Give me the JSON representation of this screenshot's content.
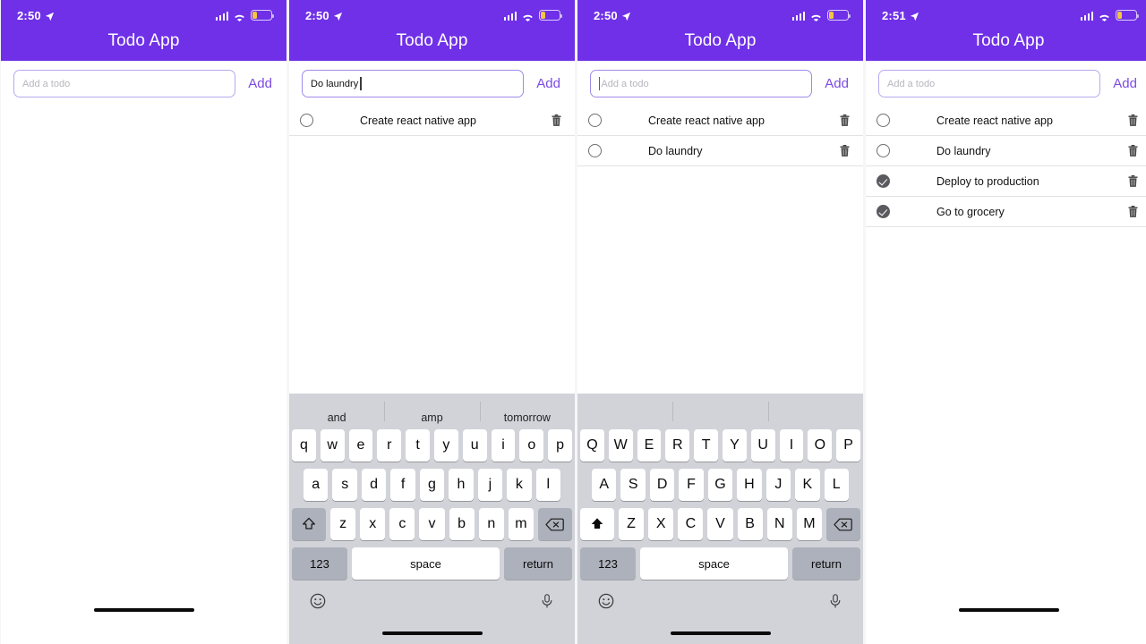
{
  "app": {
    "title": "Todo App",
    "header_color": "#6f30e8",
    "accent_color": "#7b4ae2",
    "add_label": "Add",
    "input_placeholder": "Add a todo",
    "icons": {
      "location": "location-arrow-icon",
      "signal": "cellular-signal-icon",
      "wifi": "wifi-icon",
      "battery": "battery-low-icon",
      "delete": "trash-icon",
      "checkbox_empty": "circle-unchecked-icon",
      "checkbox_done": "circle-checked-icon",
      "emoji": "emoji-icon",
      "mic": "microphone-icon",
      "shift": "shift-icon",
      "backspace": "backspace-icon"
    }
  },
  "keyboard": {
    "row1_lower": [
      "q",
      "w",
      "e",
      "r",
      "t",
      "y",
      "u",
      "i",
      "o",
      "p"
    ],
    "row2_lower": [
      "a",
      "s",
      "d",
      "f",
      "g",
      "h",
      "j",
      "k",
      "l"
    ],
    "row3_lower": [
      "z",
      "x",
      "c",
      "v",
      "b",
      "n",
      "m"
    ],
    "row1_upper": [
      "Q",
      "W",
      "E",
      "R",
      "T",
      "Y",
      "U",
      "I",
      "O",
      "P"
    ],
    "row2_upper": [
      "A",
      "S",
      "D",
      "F",
      "G",
      "H",
      "J",
      "K",
      "L"
    ],
    "row3_upper": [
      "Z",
      "X",
      "C",
      "V",
      "B",
      "N",
      "M"
    ],
    "numeric_label": "123",
    "space_label": "space",
    "return_label": "return"
  },
  "panels": [
    {
      "id": "panel-1-empty",
      "time": "2:50",
      "input_value": "",
      "input_focused": false,
      "caret": "none",
      "todos": [],
      "keyboard_visible": false,
      "suggestions": []
    },
    {
      "id": "panel-2-typing",
      "time": "2:50",
      "input_value": "Do laundry",
      "input_focused": true,
      "caret": "trailing",
      "todos": [
        {
          "label": "Create react native app",
          "done": false
        }
      ],
      "keyboard_visible": true,
      "keyboard_case": "lower",
      "shift_active": false,
      "suggestions": [
        "and",
        "amp",
        "tomorrow"
      ]
    },
    {
      "id": "panel-3-added",
      "time": "2:50",
      "input_value": "",
      "input_focused": true,
      "caret": "leading",
      "todos": [
        {
          "label": "Create react native app",
          "done": false
        },
        {
          "label": "Do laundry",
          "done": false
        }
      ],
      "keyboard_visible": true,
      "keyboard_case": "upper",
      "shift_active": true,
      "suggestions": [
        "",
        "",
        ""
      ]
    },
    {
      "id": "panel-4-completed",
      "time": "2:51",
      "input_value": "",
      "input_focused": false,
      "caret": "none",
      "todos": [
        {
          "label": "Create react native app",
          "done": false
        },
        {
          "label": "Do laundry",
          "done": false
        },
        {
          "label": "Deploy to production",
          "done": true
        },
        {
          "label": "Go to grocery",
          "done": true
        }
      ],
      "keyboard_visible": false,
      "suggestions": []
    }
  ]
}
